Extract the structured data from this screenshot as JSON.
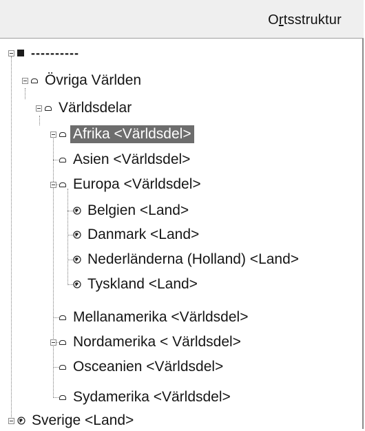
{
  "header": {
    "title_prefix": "O",
    "title_underlined": "r",
    "title_suffix": "tsstruktur"
  },
  "tree": {
    "root_label": "----------",
    "items": [
      {
        "label": "Övriga Världen",
        "icon": "container-icon"
      },
      {
        "label": "Världsdelar",
        "icon": "container-icon"
      },
      {
        "label": "Afrika <Världsdel>",
        "icon": "container-icon",
        "selected": true
      },
      {
        "label": "Asien <Världsdel>",
        "icon": "container-icon"
      },
      {
        "label": "Europa <Världsdel>",
        "icon": "container-icon"
      },
      {
        "label": "Belgien <Land>",
        "icon": "land-icon"
      },
      {
        "label": "Danmark <Land>",
        "icon": "land-icon"
      },
      {
        "label": "Nederländerna (Holland) <Land>",
        "icon": "land-icon"
      },
      {
        "label": "Tyskland <Land>",
        "icon": "land-icon"
      },
      {
        "label": "Mellanamerika <Världsdel>",
        "icon": "container-icon"
      },
      {
        "label": "Nordamerika < Världsdel>",
        "icon": "container-icon"
      },
      {
        "label": "Osceanien <Världsdel>",
        "icon": "container-icon"
      },
      {
        "label": "Sydamerika <Världsdel>",
        "icon": "container-icon"
      },
      {
        "label": "Sverige <Land>",
        "icon": "land-icon"
      }
    ]
  },
  "colors": {
    "selection": "#6d6d6d",
    "header_bg": "#efefef"
  }
}
